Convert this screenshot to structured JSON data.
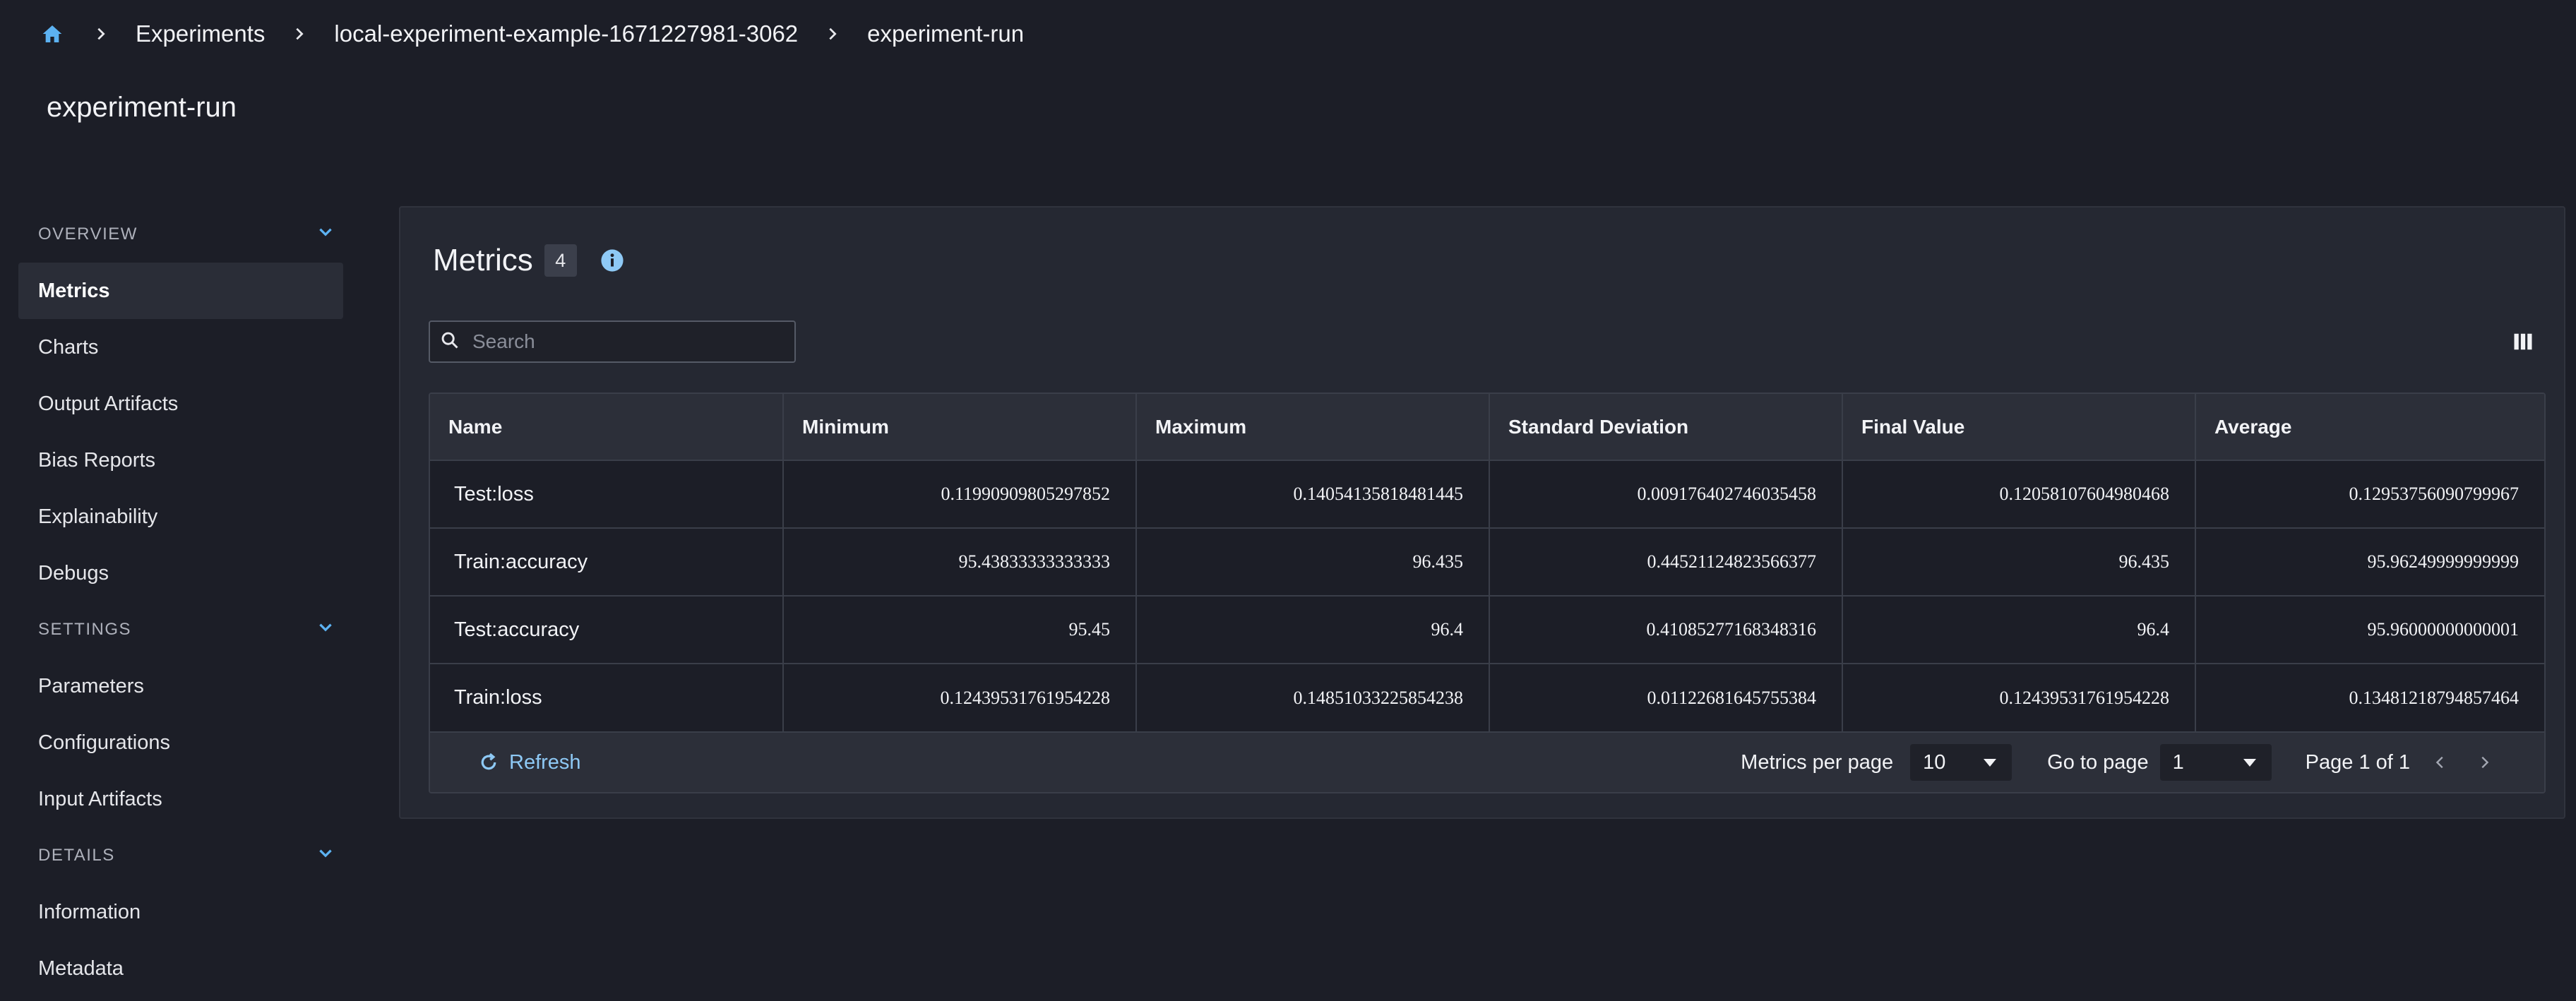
{
  "breadcrumb": {
    "items": [
      "Experiments",
      "local-experiment-example-1671227981-3062",
      "experiment-run"
    ]
  },
  "page_title": "experiment-run",
  "sidebar": {
    "sections": [
      {
        "header": "OVERVIEW",
        "items": [
          "Metrics",
          "Charts",
          "Output Artifacts",
          "Bias Reports",
          "Explainability",
          "Debugs"
        ]
      },
      {
        "header": "SETTINGS",
        "items": [
          "Parameters",
          "Configurations",
          "Input Artifacts"
        ]
      },
      {
        "header": "DETAILS",
        "items": [
          "Information",
          "Metadata"
        ]
      }
    ],
    "active_item": "Metrics"
  },
  "panel": {
    "title": "Metrics",
    "count": "4",
    "search_placeholder": "Search"
  },
  "table": {
    "columns": [
      "Name",
      "Minimum",
      "Maximum",
      "Standard Deviation",
      "Final Value",
      "Average"
    ],
    "rows": [
      [
        "Test:loss",
        "0.11990909805297852",
        "0.14054135818481445",
        "0.009176402746035458",
        "0.12058107604980468",
        "0.12953756090799967"
      ],
      [
        "Train:accuracy",
        "95.43833333333333",
        "96.435",
        "0.44521124823566377",
        "96.435",
        "95.96249999999999"
      ],
      [
        "Test:accuracy",
        "95.45",
        "96.4",
        "0.41085277168348316",
        "96.4",
        "95.96000000000001"
      ],
      [
        "Train:loss",
        "0.12439531761954228",
        "0.14851033225854238",
        "0.01122681645755384",
        "0.12439531761954228",
        "0.13481218794857464"
      ]
    ]
  },
  "footer": {
    "refresh_label": "Refresh",
    "per_page_label": "Metrics per page",
    "per_page_value": "10",
    "goto_label": "Go to page",
    "goto_value": "1",
    "page_status": "Page 1 of 1"
  },
  "colors": {
    "background": "#1c1e27",
    "panel": "#252832",
    "accent": "#8ec9f5",
    "home_icon": "#5cb2f2"
  },
  "icons": [
    "home-icon",
    "chevron-right-icon",
    "chevron-down-icon",
    "info-icon",
    "search-icon",
    "columns-icon",
    "refresh-icon",
    "chevron-left-icon"
  ]
}
